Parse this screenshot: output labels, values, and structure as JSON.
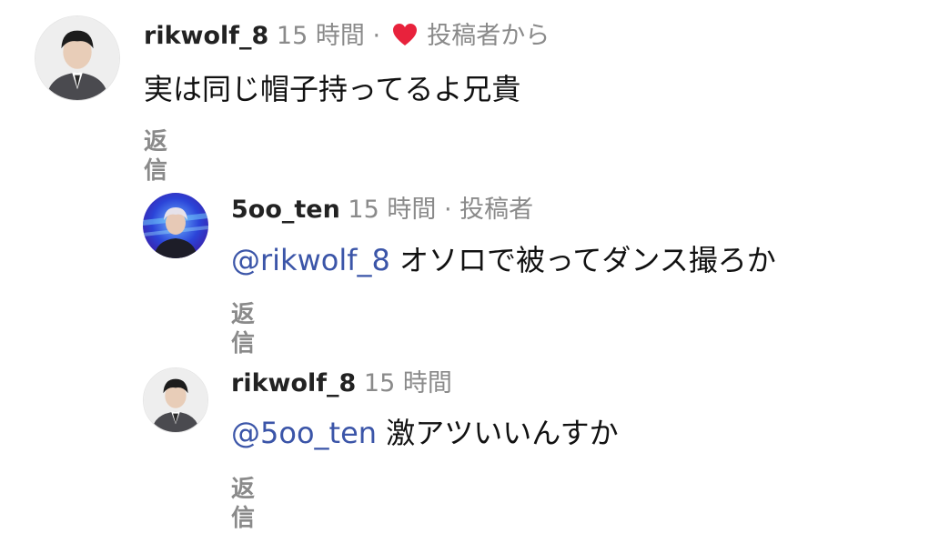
{
  "comments": [
    {
      "username": "rikwolf_8",
      "time": "15 時間",
      "separator": "·",
      "liked_by_author": true,
      "author_tag": "投稿者から",
      "mention": "",
      "text": "実は同じ帽子持ってるよ兄貴",
      "reply_label": "返信",
      "avatar_icon": "user-avatar-icon"
    },
    {
      "username": "5oo_ten",
      "time": "15 時間",
      "separator": "·",
      "author_tag": "投稿者",
      "mention": "@rikwolf_8",
      "text": "オソロで被ってダンス撮ろか",
      "reply_label": "返信",
      "avatar_icon": "user-avatar-icon"
    },
    {
      "username": "rikwolf_8",
      "time": "15 時間",
      "mention": "@5oo_ten",
      "text": "激アツいいんすか",
      "reply_label": "返信",
      "avatar_icon": "user-avatar-icon"
    }
  ],
  "colors": {
    "heart": "#e8223c",
    "mention": "#3b55a8",
    "muted": "#8a8a8a"
  },
  "icons": {
    "heart": "heart-icon"
  }
}
